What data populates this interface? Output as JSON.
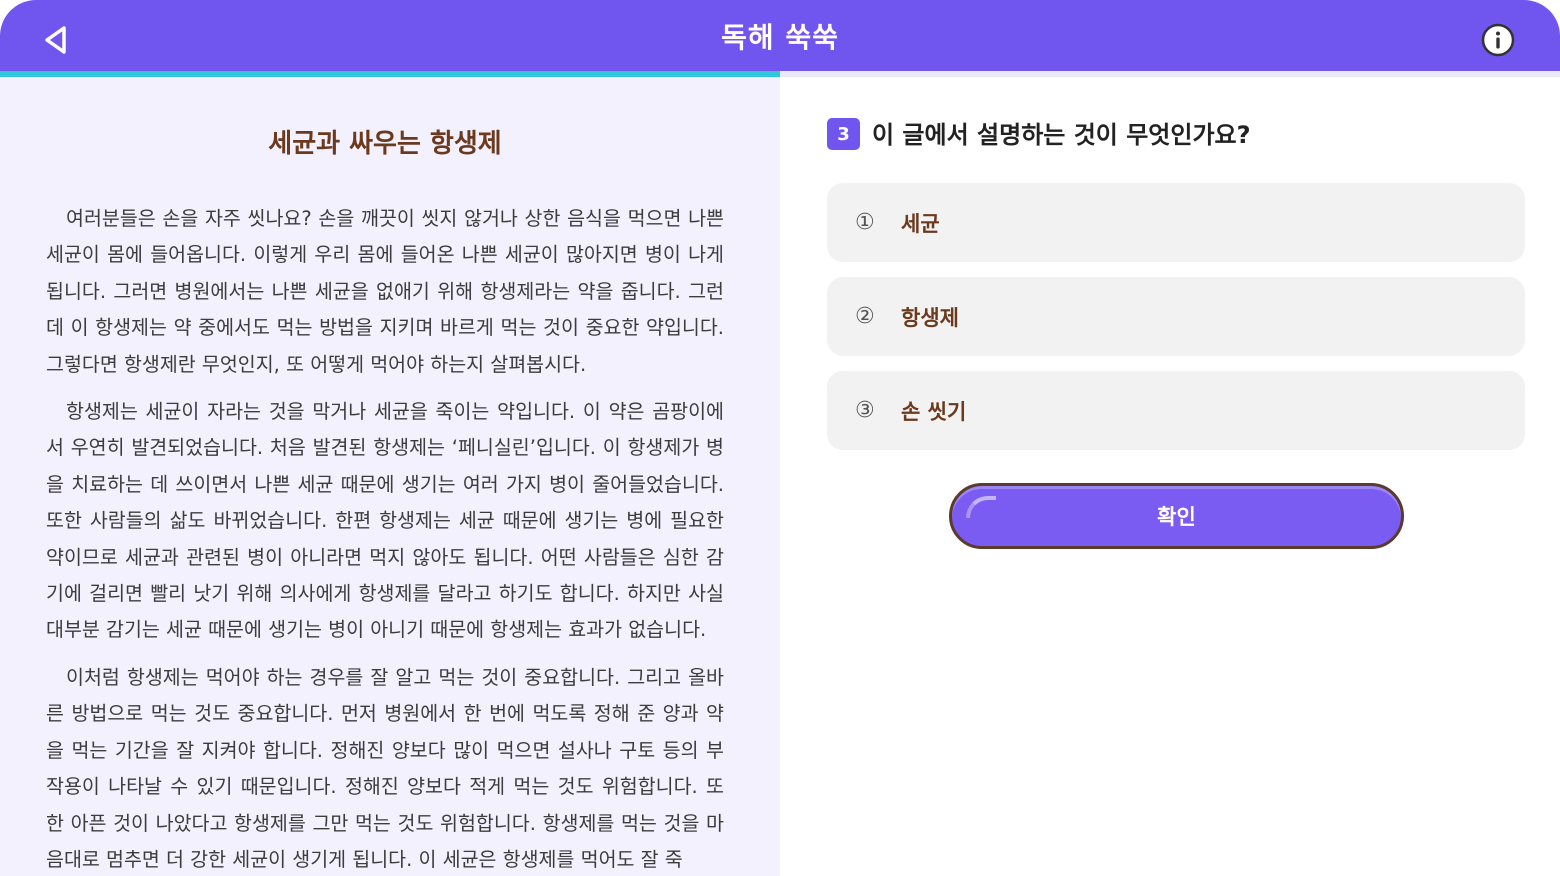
{
  "header": {
    "title": "독해 쑥쑥",
    "back_icon": "back-triangle-icon",
    "info_icon": "info-circle-icon"
  },
  "progress": {
    "percent": 50
  },
  "passage": {
    "title": "세균과 싸우는 항생제",
    "paragraphs": [
      "여러분들은 손을 자주 씻나요? 손을 깨끗이 씻지 않거나 상한 음식을 먹으면 나쁜 세균이 몸에 들어옵니다. 이렇게 우리 몸에 들어온 나쁜 세균이 많아지면 병이 나게 됩니다. 그러면 병원에서는 나쁜 세균을 없애기 위해 항생제라는 약을 줍니다. 그런데 이 항생제는 약 중에서도 먹는 방법을 지키며 바르게 먹는 것이 중요한 약입니다. 그렇다면 항생제란 무엇인지, 또 어떻게 먹어야 하는지 살펴봅시다.",
      "항생제는 세균이 자라는 것을 막거나 세균을 죽이는 약입니다. 이 약은 곰팡이에서 우연히 발견되었습니다. 처음 발견된 항생제는 ‘페니실린’입니다. 이 항생제가 병을 치료하는 데 쓰이면서 나쁜 세균 때문에 생기는 여러 가지 병이 줄어들었습니다. 또한 사람들의 삶도 바뀌었습니다. 한편 항생제는 세균 때문에 생기는 병에 필요한 약이므로 세균과 관련된 병이 아니라면 먹지 않아도 됩니다. 어떤 사람들은 심한 감기에 걸리면 빨리 낫기 위해 의사에게 항생제를 달라고 하기도 합니다. 하지만 사실 대부분 감기는 세균 때문에 생기는 병이 아니기 때문에 항생제는 효과가 없습니다.",
      "이처럼 항생제는 먹어야 하는 경우를 잘 알고 먹는 것이 중요합니다. 그리고 올바른 방법으로 먹는 것도 중요합니다. 먼저 병원에서 한 번에 먹도록 정해 준 양과 약을 먹는 기간을 잘 지켜야 합니다. 정해진 양보다 많이 먹으면 설사나 구토 등의 부작용이 나타날 수 있기 때문입니다. 정해진 양보다 적게 먹는 것도 위험합니다. 또 한 아픈 것이 나았다고 항생제를 그만 먹는 것도 위험합니다. 항생제를 먹는 것을 마음대로 멈추면 더 강한 세균이 생기게 됩니다. 이 세균은 항생제를 먹어도 잘 죽"
    ]
  },
  "question": {
    "number": "3",
    "text": "이 글에서 설명하는 것이 무엇인가요?",
    "options": [
      {
        "marker": "①",
        "label": "세균"
      },
      {
        "marker": "②",
        "label": "항생제"
      },
      {
        "marker": "③",
        "label": "손 씻기"
      }
    ],
    "confirm_label": "확인"
  },
  "colors": {
    "header": "#7056ee",
    "progress": "#2fc7d9",
    "passage_bg": "#f4f1fe",
    "title_brown": "#6b3a1e",
    "option_bg": "#f3f2f2",
    "button": "#7b5cf2"
  }
}
